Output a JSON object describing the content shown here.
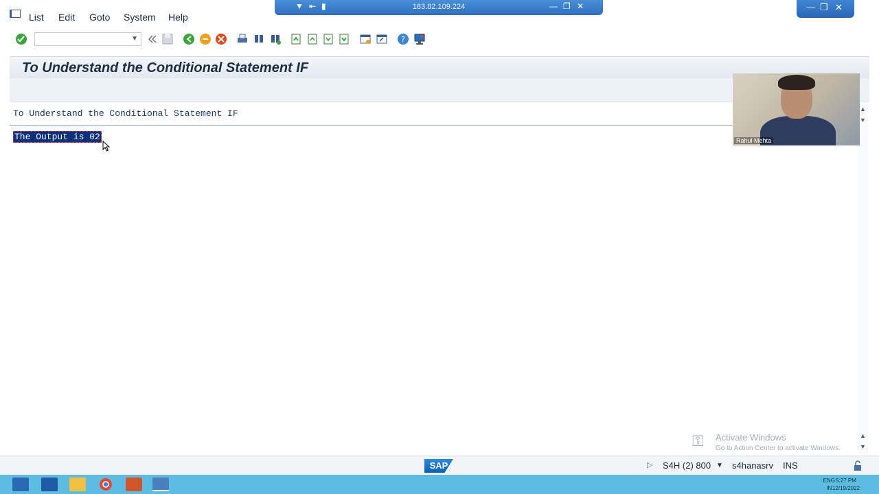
{
  "remote_bar": {
    "ip": "183.82.109.224"
  },
  "menu": {
    "items": [
      "List",
      "Edit",
      "Goto",
      "System",
      "Help"
    ]
  },
  "toolbar": {
    "command_field_value": "",
    "icons": [
      "enter-icon",
      "back-double-icon",
      "save-icon",
      "back-icon",
      "exit-icon",
      "cancel-icon",
      "print-icon",
      "find-icon",
      "find-next-icon",
      "first-page-icon",
      "previous-page-icon",
      "next-page-icon",
      "last-page-icon",
      "create-session-icon",
      "shortcut-icon",
      "help-icon",
      "customize-layout-icon"
    ]
  },
  "title": "To Understand the Conditional Statement IF",
  "list": {
    "header": "To Understand the Conditional Statement IF",
    "output": "The Output is 02"
  },
  "webcam": {
    "name": "Rahul Mehta"
  },
  "watermark": {
    "line1": "Activate Windows",
    "line2": "Go to Action Center to activate Windows."
  },
  "status": {
    "system": "S4H (2) 800",
    "server": "s4hanasrv",
    "mode": "INS"
  },
  "taskbar": {
    "lang_line1": "ENG",
    "lang_line2": "IN",
    "time": "5:27 PM",
    "date": "12/19/2022"
  },
  "colors": {
    "selection": "#0b2f7a",
    "taskbar": "#5cbde0",
    "sap_blue": "#0a5fb4"
  }
}
